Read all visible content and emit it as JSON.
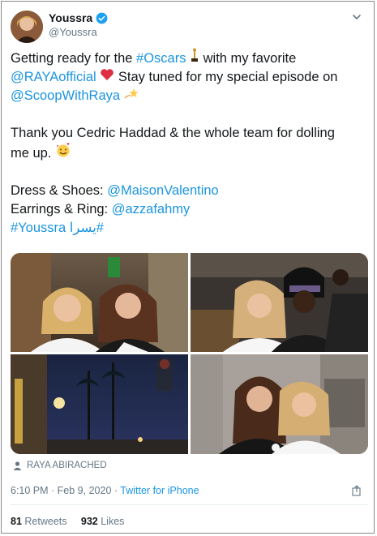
{
  "user": {
    "display_name": "Youssra",
    "handle": "@Youssra"
  },
  "tweet": {
    "line1_pre": "Getting ready for the ",
    "line1_tag": "#Oscars",
    "line2_mention": "@RAYAofficial",
    "line2_post": " Stay tuned for my special episode on",
    "line3_mention": "@ScoopWithRaya",
    "line1_post": " with my favorite",
    "para2_line1": "Thank you Cedric Haddad & the whole team for dolling",
    "para2_line2": "me up.",
    "dress_label": "Dress & Shoes: ",
    "dress_mention": "@MaisonValentino",
    "earrings_label": "Earrings & Ring: ",
    "earrings_mention": "@azzafahmy",
    "hashtags": "#Youssra يسرا#"
  },
  "attribution": "RAYA ABIRACHED",
  "meta": {
    "time": "6:10 PM",
    "date": "Feb 9, 2020",
    "source": "Twitter for iPhone"
  },
  "stats": {
    "retweets_count": "81",
    "retweets_label": "Retweets",
    "likes_count": "932",
    "likes_label": "Likes"
  },
  "colors": {
    "link": "#1b95e0",
    "secondary": "#657786",
    "primary": "#14171a"
  },
  "icons": {
    "verified": "verified-badge-icon",
    "caret": "chevron-down-icon",
    "oscar": "oscar-trophy-emoji",
    "heart": "red-heart-emoji",
    "sparkle": "dizzy-star-emoji",
    "smile": "smiling-face-with-hearts-emoji",
    "person": "person-icon",
    "share": "share-icon"
  }
}
